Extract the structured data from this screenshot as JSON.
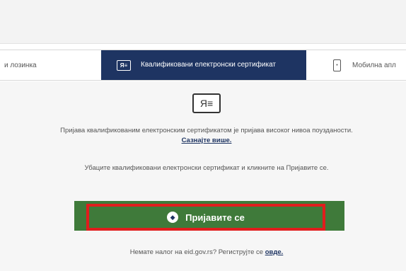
{
  "tabs": {
    "left_label": "и лозинка",
    "active_label": "Квалификовани електронски сертификат",
    "active_icon": "certificate-card-icon",
    "right_label": "Мобилна апл",
    "right_icon": "mobile-phone-icon"
  },
  "main": {
    "icon": "certificate-card-icon",
    "description1": "Пријава квалификованим електронским сертификатом је пријава високог нивоа поузданости.",
    "learn_more": "Сазнајте више.",
    "description2": "Убаците квалификовани електронски сертификат и кликните на Пријавите се.",
    "login_button": "Пријавите се",
    "login_icon": "login-shield-icon"
  },
  "footer": {
    "text": "Немате налог на eid.gov.rs? Региструјте се",
    "link": "овде."
  },
  "colors": {
    "active_tab": "#1e3462",
    "button": "#3f7a3a",
    "highlight": "#e11d1d"
  }
}
